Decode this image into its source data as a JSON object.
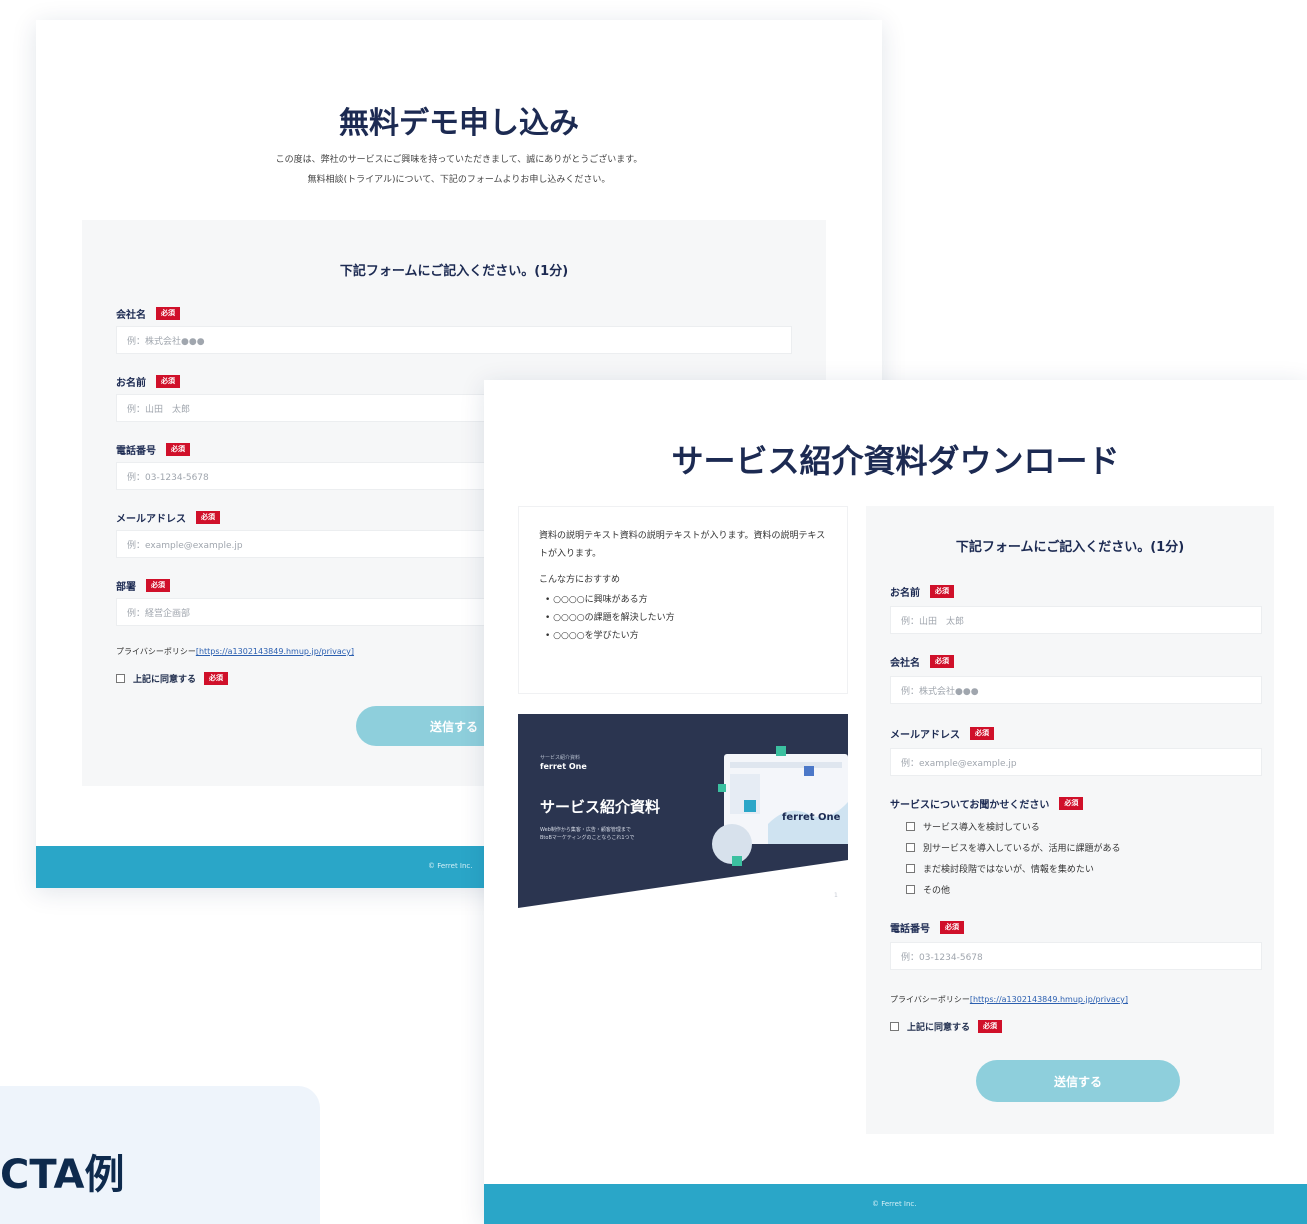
{
  "window1": {
    "title": "無料デモ申し込み",
    "intro_line1": "この度は、弊社のサービスにご興味を持っていただきまして、誠にありがとうございます。",
    "intro_line2": "無料相談(トライアル)について、下記のフォームよりお申し込みください。",
    "form_heading": "下記フォームにご記入ください。(1分)",
    "required_badge": "必須",
    "fields": [
      {
        "label": "会社名",
        "placeholder": "例：株式会社●●●"
      },
      {
        "label": "お名前",
        "placeholder": "例：山田　太郎"
      },
      {
        "label": "電話番号",
        "placeholder": "例：03-1234-5678"
      },
      {
        "label": "メールアドレス",
        "placeholder": "例：example@example.jp"
      },
      {
        "label": "部署",
        "placeholder": "例：経営企画部"
      }
    ],
    "privacy_label": "プライバシーポリシー",
    "privacy_link": "[https://a1302143849.hmup.jp/privacy]",
    "agree_label": "上記に同意する",
    "submit_label": "送信する",
    "copyright": "© Ferret Inc."
  },
  "window2": {
    "title": "サービス紹介資料ダウンロード",
    "description": "資料の説明テキスト資料の説明テキストが入ります。資料の説明テキストが入ります。",
    "recommend_heading": "こんな方におすすめ",
    "recommend_items": [
      "• ○○○○に興味がある方",
      "• ○○○○の課題を解決したい方",
      "• ○○○○を学びたい方"
    ],
    "banner": {
      "small_caption": "サービス紹介資料",
      "logo_text": "ferret One",
      "headline": "サービス紹介資料",
      "subtext_line1": "Web制作から集客・広告・顧客管理まで",
      "subtext_line2": "BtoBマーケティングのことならこれ1つで",
      "screen_logo": "ferret One",
      "page_no": "1"
    },
    "form_heading": "下記フォームにご記入ください。(1分)",
    "required_badge": "必須",
    "fields_top": [
      {
        "label": "お名前",
        "placeholder": "例：山田　太郎"
      },
      {
        "label": "会社名",
        "placeholder": "例：株式会社●●●"
      },
      {
        "label": "メールアドレス",
        "placeholder": "例：example@example.jp"
      }
    ],
    "service_question": "サービスについてお聞かせください",
    "service_options": [
      "サービス導入を検討している",
      "別サービスを導入しているが、活用に課題がある",
      "まだ検討段階ではないが、情報を集めたい",
      "その他"
    ],
    "phone_label": "電話番号",
    "phone_placeholder": "例：03-1234-5678",
    "privacy_label": "プライバシーポリシー",
    "privacy_link": "[https://a1302143849.hmup.jp/privacy]",
    "agree_label": "上記に同意する",
    "submit_label": "送信する",
    "copyright": "© Ferret Inc."
  },
  "cta_label": "CTA例",
  "colors": {
    "navy": "#1c2a52",
    "required_red": "#d0102a",
    "footer_teal": "#2aa6c8",
    "button_light_teal": "#8ecfdc",
    "form_bg": "#f6f7f8"
  }
}
